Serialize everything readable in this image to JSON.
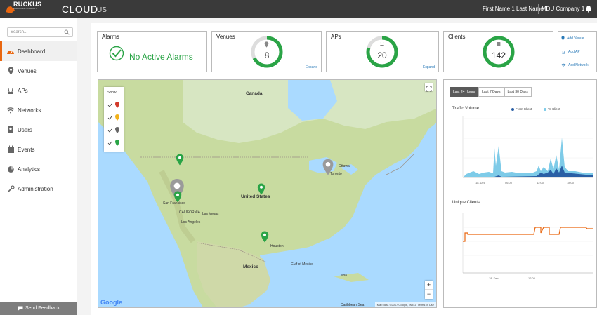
{
  "header": {
    "logo_text": "RUCKUS",
    "logo_sub": "A BROCADE COMPANY",
    "app_name": "CLOUD",
    "region": "US",
    "user": "First Name 1 Last Name 1",
    "company": "MDU Company 1",
    "colors": {
      "bar": "#3a3a3a",
      "accent": "#e9660f"
    }
  },
  "sidebar": {
    "search_placeholder": "Search...",
    "items": [
      {
        "label": "Dashboard",
        "icon": "dashboard-icon",
        "active": true
      },
      {
        "label": "Venues",
        "icon": "location-pin-icon"
      },
      {
        "label": "APs",
        "icon": "access-point-icon"
      },
      {
        "label": "Networks",
        "icon": "wifi-icon"
      },
      {
        "label": "Users",
        "icon": "users-icon"
      },
      {
        "label": "Events",
        "icon": "events-icon"
      },
      {
        "label": "Analytics",
        "icon": "pie-chart-icon"
      },
      {
        "label": "Administration",
        "icon": "wrench-icon"
      }
    ],
    "feedback": "Send Feedback"
  },
  "cards": {
    "alarms": {
      "title": "Alarms",
      "status": "No Active Alarms"
    },
    "venues": {
      "title": "Venues",
      "value": "8",
      "expand": "Expand"
    },
    "aps": {
      "title": "APs",
      "value": "20",
      "expand": "Expand"
    },
    "clients": {
      "title": "Clients",
      "value": "142"
    }
  },
  "quick_actions": [
    {
      "label": "Add Venue",
      "icon": "location-pin-icon"
    },
    {
      "label": "Add AP",
      "icon": "access-point-icon"
    },
    {
      "label": "Add Network",
      "icon": "wifi-icon"
    }
  ],
  "map": {
    "legend_title": "Show:",
    "labels": {
      "canada": "Canada",
      "united_states": "United States",
      "mexico": "Mexico",
      "ottawa": "Ottawa",
      "toronto": "Toronto",
      "houston": "Houston",
      "san_francisco": "San Francisco",
      "california": "CALIFORNIA",
      "las_vegas": "Las Vegas",
      "los_angeles": "Los Angeles",
      "cuba": "Cuba",
      "gulf": "Gulf of Mexico",
      "caribbean": "Caribbean Sea"
    },
    "footer": "Map data ©2017 Google, INEGI   Terms of Use",
    "google": "Google",
    "zoom_in": "+",
    "zoom_out": "−"
  },
  "traffic": {
    "tabs": [
      "Last 24 Hours",
      "Last 7 Days",
      "Last 30 Days"
    ],
    "volume_title": "Traffic Volume",
    "series_from": "From Client",
    "series_to": "To Client",
    "clients_title": "Unique Clients",
    "x_ticks": [
      "18. Dec",
      "06:00",
      "12:00",
      "18:00"
    ],
    "colors": {
      "from": "#2a5fa5",
      "to": "#7ecbe8",
      "clients": "#e9660f"
    }
  }
}
